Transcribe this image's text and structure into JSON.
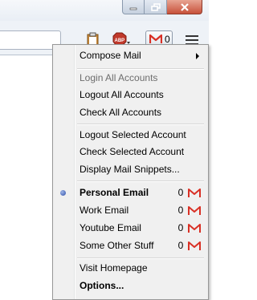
{
  "menu": {
    "compose": "Compose Mail",
    "login_all": "Login All Accounts",
    "logout_all": "Logout All Accounts",
    "check_all": "Check All Accounts",
    "logout_selected": "Logout Selected Account",
    "check_selected": "Check Selected Account",
    "display_snippets": "Display Mail Snippets...",
    "accounts": [
      {
        "name": "Personal Email",
        "count": "0",
        "selected": true
      },
      {
        "name": "Work Email",
        "count": "0",
        "selected": false
      },
      {
        "name": "Youtube Email",
        "count": "0",
        "selected": false
      },
      {
        "name": "Some Other Stuff",
        "count": "0",
        "selected": false
      }
    ],
    "visit_homepage": "Visit Homepage",
    "options": "Options..."
  },
  "toolbar": {
    "gmail_count": "0",
    "icons": [
      "clipboard-icon",
      "adblock-icon",
      "gmail-icon",
      "menu-icon"
    ]
  },
  "window_controls": [
    "minimize",
    "maximize",
    "close"
  ],
  "colors": {
    "gmail_red": "#d93025",
    "selected_dot": "#2f4fa8"
  }
}
